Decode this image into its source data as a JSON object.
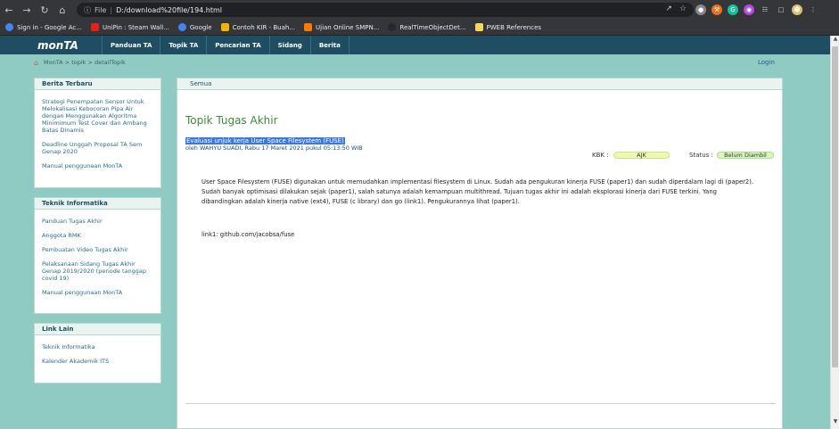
{
  "browser": {
    "scheme_label": "File",
    "url": "D:/download%20file/194.html",
    "bookmarks": [
      {
        "label": "Sign in - Google Ac...",
        "color": "#4285f4"
      },
      {
        "label": "UniPin : Steam Wall...",
        "color": "#e62117"
      },
      {
        "label": "Google",
        "color": "#4285f4"
      },
      {
        "label": "Contoh KIR - Buah...",
        "color": "#f4b400"
      },
      {
        "label": "Ujian Online SMPN...",
        "color": "#f57c00"
      },
      {
        "label": "RealTimeObjectDet...",
        "color": "#24292e"
      },
      {
        "label": "PWEB References",
        "color": "#f9d65c"
      }
    ]
  },
  "site": {
    "logo": "monTA",
    "menu": [
      "Panduan TA",
      "Topik TA",
      "Pencarian TA",
      "Sidang",
      "Berita"
    ],
    "breadcrumb": "MonTA > topik > detailTopik",
    "login": "Login"
  },
  "sidebar": {
    "berita": {
      "title": "Berita Terbaru",
      "links": [
        "Strategi Penempatan Sensor Untuk Melokalisasi Kebocoran Pipa Air dengan Menggunakan Algoritma Minimimum Test Cover dan Ambang Batas Dinamis",
        "Deadline Unggah Proposal TA Sem Genap 2020",
        "Manual penggunaan MonTA"
      ]
    },
    "teknik": {
      "title": "Teknik Informatika",
      "links": [
        "Panduan Tugas Akhir",
        "Anggota RMK",
        "Pembuatan Video Tugas Akhir",
        "Pelaksanaan Sidang Tugas Akhir Genap 2019/2020 (periode tanggap covid 19)",
        "Manual penggunaan MonTA"
      ]
    },
    "link_lain": {
      "title": "Link Lain",
      "links": [
        "Teknik Informatika",
        "Kalender Akademik ITS"
      ]
    }
  },
  "main": {
    "tab": "Semua",
    "title": "Topik Tugas Akhir",
    "topic_title": "Evaluasi unjuk kerja User Space Filesystem (FUSE)",
    "meta": "oleh WAHYU SUADI, Rabu 17 Maret 2021 pukul 05:13:50 WIB",
    "kbk_label": "KBK :",
    "kbk_value": "AJK",
    "status_label": "Status :",
    "status_value": "Belum Diambil",
    "description": "User Space Filesystem (FUSE) digunakan untuk memudahkan implementasi filesystem di Linux. Sudah ada pengukuran kinerja FUSE (paper1) dan sudah diperdalam lagi di (paper2). Sudah banyak optimisasi dilakukan sejak (paper1), salah satunya adalah kemampuan multithread. Tujuan tugas akhir ini adalah eksplorasi kinerja dari FUSE terkini. Yang dibandingkan adalah kinerja native (ext4), FUSE (c library) dan go (link1). Pengukurannya lihat (paper1).",
    "link1": "link1: github.com/jacobsa/fuse"
  }
}
